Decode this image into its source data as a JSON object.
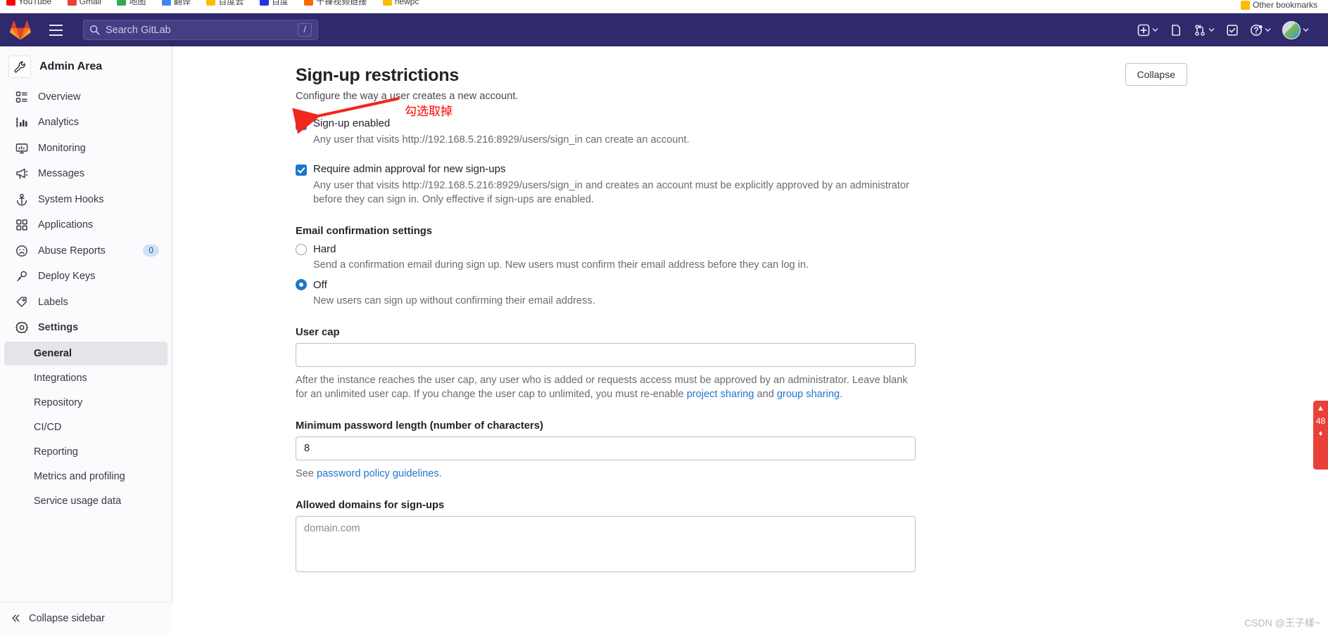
{
  "browser": {
    "bookmarks": [
      {
        "label": "YouTube",
        "color": "#ff0000"
      },
      {
        "label": "Gmail",
        "color": "#ea4335"
      },
      {
        "label": "地图",
        "color": "#34a853"
      },
      {
        "label": "翻译",
        "color": "#4285f4"
      },
      {
        "label": "百度云",
        "color": "#fbbc05"
      },
      {
        "label": "百度",
        "color": "#2932e1"
      },
      {
        "label": "千锋视频链接",
        "color": "#ff6a00"
      },
      {
        "label": "newpc",
        "color": "#fbbc05"
      }
    ],
    "other_bookmarks": "Other bookmarks"
  },
  "header": {
    "logo": "gitlab-logo-icon",
    "hamburger": "hamburger-menu-icon",
    "search": {
      "placeholder": "Search GitLab",
      "value": "",
      "shortcut": "/"
    },
    "actions": [
      {
        "name": "create-new-icon",
        "caret": true
      },
      {
        "name": "issues-icon",
        "caret": false
      },
      {
        "name": "merge-requests-icon",
        "caret": true
      },
      {
        "name": "todos-icon",
        "caret": false
      },
      {
        "name": "help-icon",
        "caret": true
      },
      {
        "name": "avatar",
        "caret": true
      }
    ]
  },
  "sidebar": {
    "title": "Admin Area",
    "title_icon": "wrench-icon",
    "items": [
      {
        "label": "Overview",
        "icon": "overview-icon",
        "badge": null
      },
      {
        "label": "Analytics",
        "icon": "analytics-icon",
        "badge": null
      },
      {
        "label": "Monitoring",
        "icon": "monitoring-icon",
        "badge": null
      },
      {
        "label": "Messages",
        "icon": "messages-icon",
        "badge": null
      },
      {
        "label": "System Hooks",
        "icon": "system-hooks-icon",
        "badge": null
      },
      {
        "label": "Applications",
        "icon": "applications-icon",
        "badge": null
      },
      {
        "label": "Abuse Reports",
        "icon": "abuse-reports-icon",
        "badge": "0"
      },
      {
        "label": "Deploy Keys",
        "icon": "deploy-keys-icon",
        "badge": null
      },
      {
        "label": "Labels",
        "icon": "labels-icon",
        "badge": null
      },
      {
        "label": "Settings",
        "icon": "settings-gear-icon",
        "badge": null
      }
    ],
    "settings_subitems": [
      {
        "label": "General",
        "active": true
      },
      {
        "label": "Integrations",
        "active": false
      },
      {
        "label": "Repository",
        "active": false
      },
      {
        "label": "CI/CD",
        "active": false
      },
      {
        "label": "Reporting",
        "active": false
      },
      {
        "label": "Metrics and profiling",
        "active": false
      },
      {
        "label": "Service usage data",
        "active": false
      }
    ],
    "collapse_label": "Collapse sidebar",
    "collapse_icon": "chevron-double-left-icon"
  },
  "main": {
    "title": "Sign-up restrictions",
    "collapse_button": "Collapse",
    "lead": "Configure the way a user creates a new account.",
    "signup_enabled": {
      "label": "Sign-up enabled",
      "checked": true,
      "description": "Any user that visits http://192.168.5.216:8929/users/sign_in can create an account."
    },
    "admin_approval": {
      "label": "Require admin approval for new sign-ups",
      "checked": true,
      "description": "Any user that visits http://192.168.5.216:8929/users/sign_in and creates an account must be explicitly approved by an administrator before they can sign in. Only effective if sign-ups are enabled."
    },
    "email_confirmation": {
      "heading": "Email confirmation settings",
      "options": [
        {
          "label": "Hard",
          "selected": false,
          "description": "Send a confirmation email during sign up. New users must confirm their email address before they can log in."
        },
        {
          "label": "Off",
          "selected": true,
          "description": "New users can sign up without confirming their email address."
        }
      ]
    },
    "user_cap": {
      "label": "User cap",
      "value": "",
      "placeholder": "",
      "help_part1": "After the instance reaches the user cap, any user who is added or requests access must be approved by an administrator. Leave blank for an unlimited user cap. If you change the user cap to unlimited, you must re-enable ",
      "help_link1": "project sharing",
      "help_mid": " and ",
      "help_link2": "group sharing",
      "help_end": "."
    },
    "min_password": {
      "label": "Minimum password length (number of characters)",
      "value": "8",
      "help_prefix": "See ",
      "help_link": "password policy guidelines",
      "help_suffix": "."
    },
    "allowed_domains": {
      "label": "Allowed domains for sign-ups",
      "value": "",
      "placeholder": "domain.com"
    }
  },
  "annotation": {
    "text": "勾选取掉",
    "color": "#ff0000"
  },
  "watermark": "CSDN @王子樣~",
  "side_widget": {
    "num": "48"
  }
}
